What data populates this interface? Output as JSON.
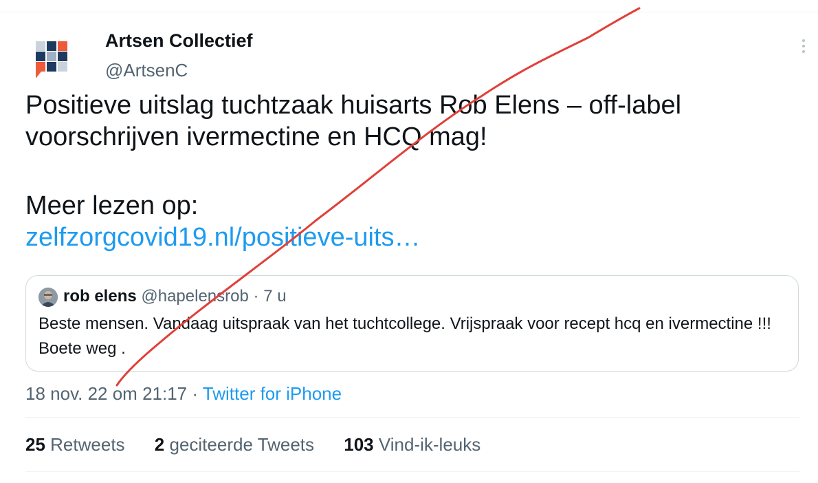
{
  "tweet": {
    "author_name": "Artsen Collectief",
    "author_handle": "@ArtsenC",
    "text_line1": "Positieve uitslag tuchtzaak huisarts Rob Elens – off-label",
    "text_line2": "voorschrijven ivermectine en HCQ mag!",
    "text_line3": "Meer lezen op:",
    "link_text": "zelfzorgcovid19.nl/positieve-uits…",
    "timestamp": "18 nov. 22 om 21:17",
    "separator": " · ",
    "source": "Twitter for iPhone"
  },
  "quoted_tweet": {
    "author_name": "rob elens",
    "author_handle": "@hapelensrob",
    "time_ago": "7 u",
    "text": "Beste mensen. Vandaag uitspraak van het tuchtcollege. Vrijspraak voor recept hcq en ivermectine !!! Boete weg ."
  },
  "stats": {
    "retweets_count": "25",
    "retweets_label": "Retweets",
    "quotes_count": "2",
    "quotes_label": "geciteerde Tweets",
    "likes_count": "103",
    "likes_label": "Vind-ik-leuks"
  },
  "icons": {
    "more": "more-vertical-icon",
    "avatar": "artsen-collectief-logo"
  },
  "colors": {
    "link": "#1d9bf0",
    "secondary_text": "#536471",
    "annotation_stroke": "#e0403a",
    "logo_navy": "#1f3a5f",
    "logo_orange": "#ef5a3a"
  }
}
